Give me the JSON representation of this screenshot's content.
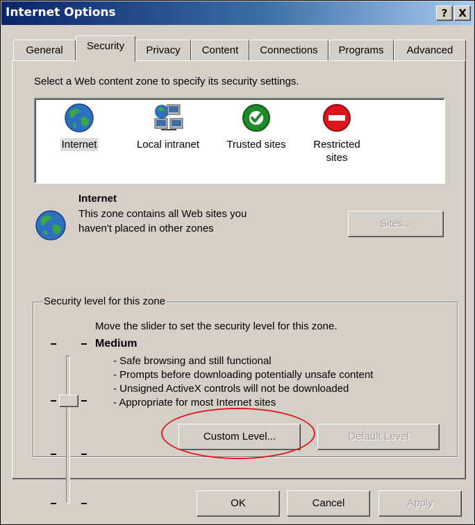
{
  "window": {
    "title": "Internet Options"
  },
  "titlebar": {
    "help_label": "?",
    "close_label": "X"
  },
  "tabs": [
    {
      "label": "General"
    },
    {
      "label": "Security"
    },
    {
      "label": "Privacy"
    },
    {
      "label": "Content"
    },
    {
      "label": "Connections"
    },
    {
      "label": "Programs"
    },
    {
      "label": "Advanced"
    }
  ],
  "security": {
    "instruction": "Select a Web content zone to specify its security settings.",
    "zones": [
      {
        "label": "Internet",
        "icon": "globe-icon",
        "selected": true
      },
      {
        "label": "Local intranet",
        "icon": "network-computers-icon",
        "selected": false
      },
      {
        "label": "Trusted sites",
        "icon": "green-check-icon",
        "selected": false
      },
      {
        "label_line1": "Restricted",
        "label_line2": "sites",
        "icon": "red-no-entry-icon",
        "selected": false
      }
    ],
    "zone_info": {
      "title": "Internet",
      "desc_line1": "This zone contains all Web sites you",
      "desc_line2": "haven't placed in other zones"
    },
    "sites_button": "Sites...",
    "level_group": {
      "legend": "Security level for this zone",
      "instruction": "Move the slider to set the security level for this zone.",
      "level_name": "Medium",
      "details": [
        "- Safe browsing and still functional",
        "- Prompts before downloading potentially unsafe content",
        "- Unsigned ActiveX controls will not be downloaded",
        "- Appropriate for most Internet sites"
      ],
      "custom_level_button": "Custom Level...",
      "default_level_button": "Default Level",
      "slider_level": "Medium"
    }
  },
  "footer": {
    "ok": "OK",
    "cancel": "Cancel",
    "apply": "Apply"
  },
  "colors": {
    "title_bar": "#0a246a",
    "dialog_face": "#d4d0c8",
    "highlight_circle": "#e0141e",
    "trusted_green": "#1f8a2a",
    "restricted_red": "#e0141e"
  }
}
